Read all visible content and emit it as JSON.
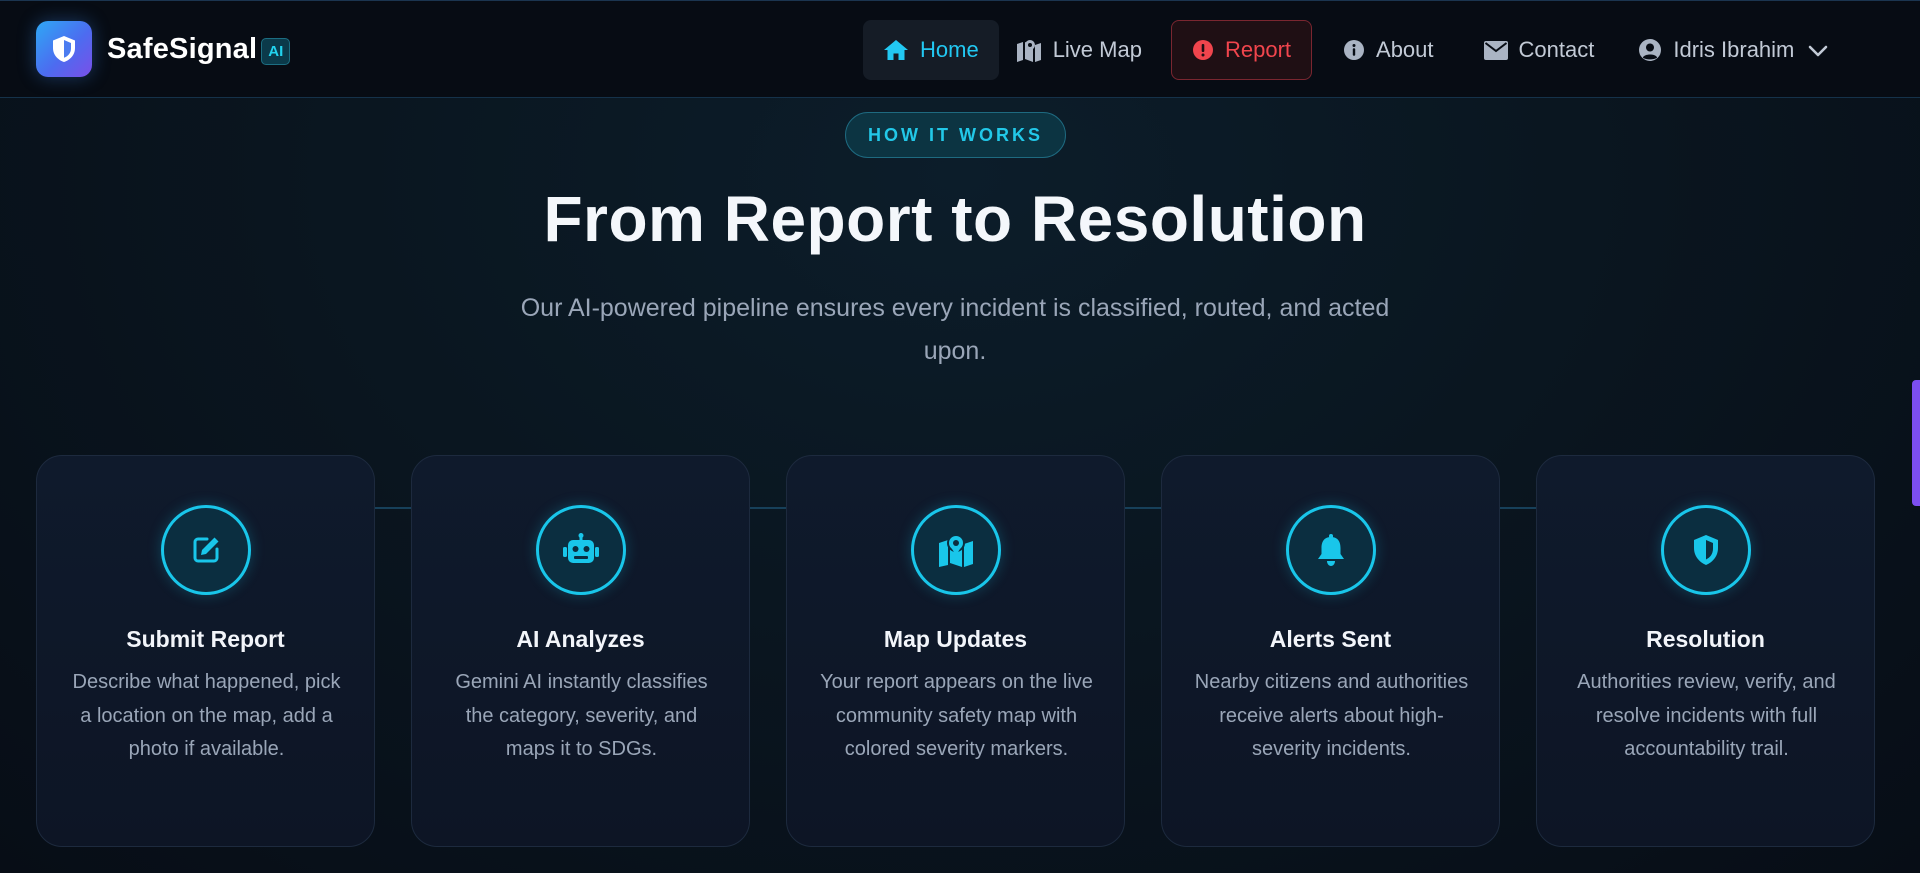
{
  "brand": {
    "name": "SafeSignal",
    "badge": "AI"
  },
  "nav": {
    "home": "Home",
    "live_map": "Live Map",
    "report": "Report",
    "about": "About",
    "contact": "Contact",
    "user": "Idris Ibrahim"
  },
  "section": {
    "pill": "HOW IT WORKS",
    "title": "From Report to Resolution",
    "subtitle": "Our AI-powered pipeline ensures every incident is classified, routed, and acted upon."
  },
  "steps": [
    {
      "title": "Submit Report",
      "text": "Describe what happened, pick a location on the map, add a photo if available.",
      "icon": "edit-icon"
    },
    {
      "title": "AI Analyzes",
      "text": "Gemini AI instantly classifies the category, severity, and maps it to SDGs.",
      "icon": "robot-icon"
    },
    {
      "title": "Map Updates",
      "text": "Your report appears on the live community safety map with colored severity markers.",
      "icon": "map-marker-icon"
    },
    {
      "title": "Alerts Sent",
      "text": "Nearby citizens and authorities receive alerts about high-severity incidents.",
      "icon": "bell-icon"
    },
    {
      "title": "Resolution",
      "text": "Authorities review, verify, and resolve incidents with full accountability trail.",
      "icon": "shield-icon"
    }
  ],
  "colors": {
    "accent": "#22c8f2",
    "report": "#f0454d",
    "scrollbar": "#7c4ef0",
    "brand_gradient_start": "#2ea8f5",
    "brand_gradient_end": "#7a4fe8"
  }
}
